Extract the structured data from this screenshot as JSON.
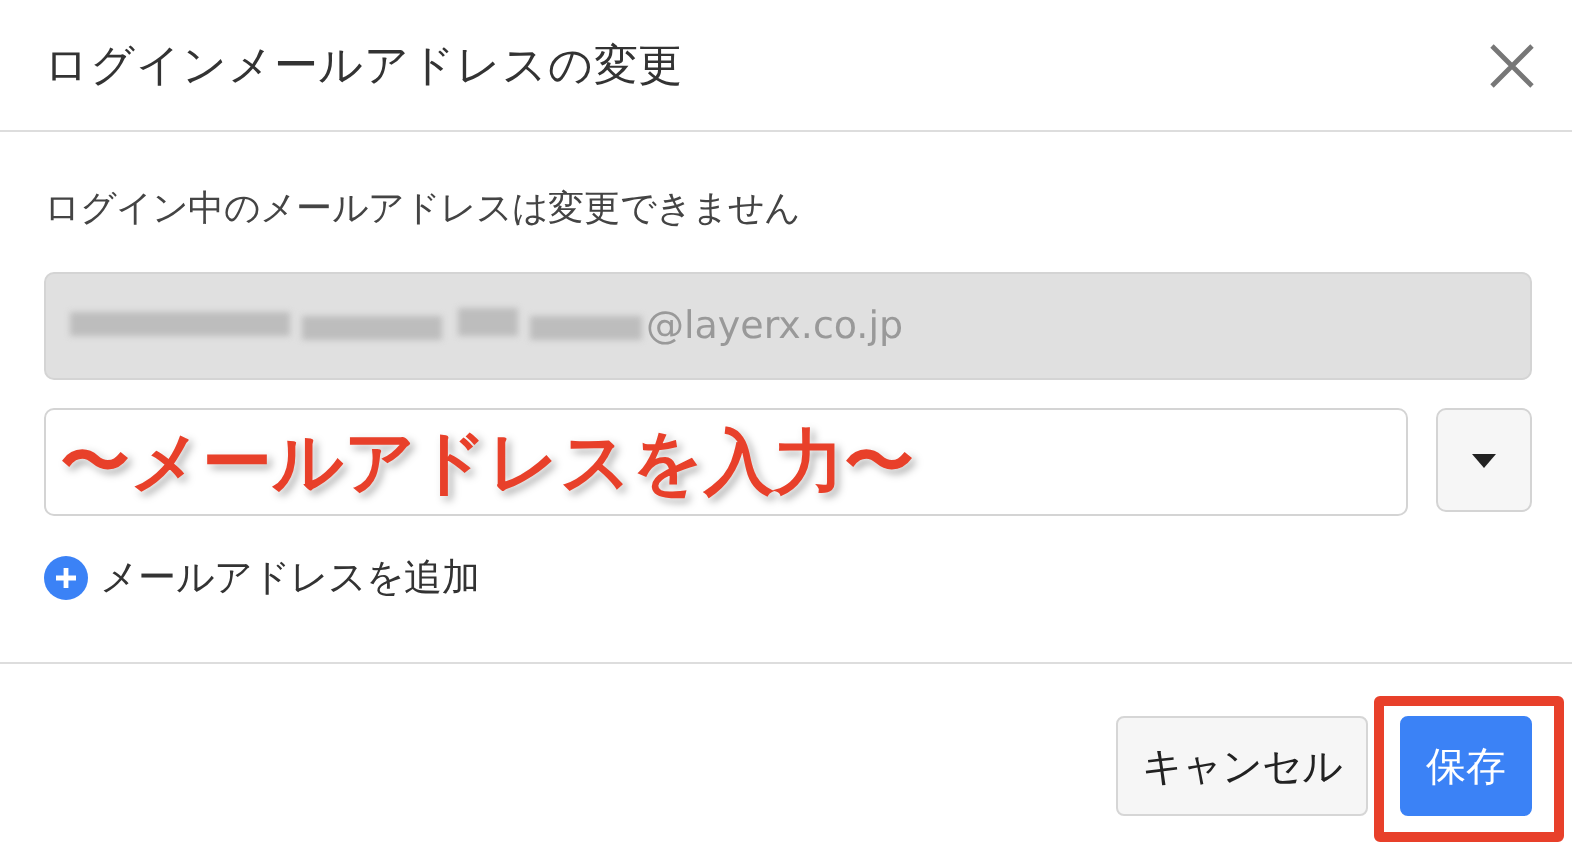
{
  "dialog": {
    "title": "ログインメールアドレスの変更",
    "note": "ログイン中のメールアドレスは変更できません",
    "current_email": {
      "value": "@layerx.co.jp",
      "disabled": true
    },
    "new_email": {
      "annotation": "〜メールアドレスを入力〜"
    },
    "add_link": "メールアドレスを追加",
    "buttons": [
      {
        "label": "キャンセル",
        "kind": "secondary",
        "highlighted": false
      },
      {
        "label": "保存",
        "kind": "primary",
        "highlighted": true
      }
    ]
  }
}
